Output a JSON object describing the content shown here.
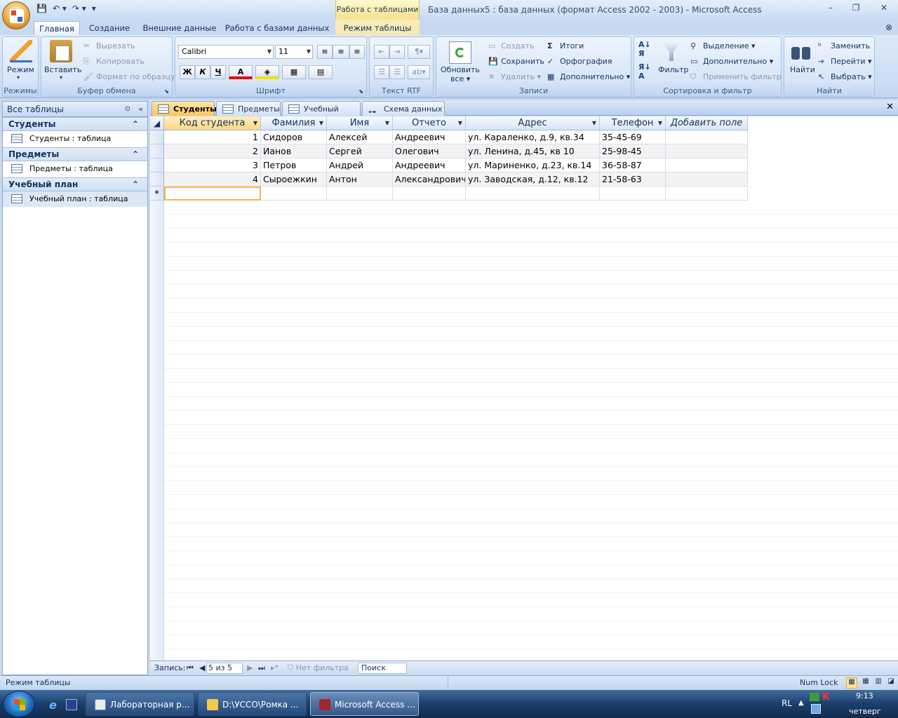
{
  "titlebar": {
    "contextual_title": "Работа с таблицами",
    "window_title": "База данных5 : база данных (формат Access 2002 - 2003)  -  Microsoft Access"
  },
  "ribbon_tabs": [
    "Главная",
    "Создание",
    "Внешние данные",
    "Работа с базами данных",
    "Режим таблицы"
  ],
  "groups": {
    "views": {
      "label": "Режимы",
      "mode": "Режим"
    },
    "clipboard": {
      "label": "Буфер обмена",
      "paste": "Вставить",
      "cut": "Вырезать",
      "copy": "Копировать",
      "format_painter": "Формат по образцу"
    },
    "font": {
      "label": "Шрифт",
      "font_name": "Calibri",
      "font_size": "11",
      "bold": "Ж",
      "italic": "К",
      "underline": "Ч",
      "font_color": "A"
    },
    "rtf": {
      "label": "Текст RTF"
    },
    "records": {
      "label": "Записи",
      "refresh": "Обновить",
      "refresh2": "все",
      "new": "Создать",
      "save": "Сохранить",
      "delete": "Удалить",
      "totals": "Итоги",
      "spelling": "Орфография",
      "more": "Дополнительно"
    },
    "sort_filter": {
      "label": "Сортировка и фильтр",
      "filter": "Фильтр",
      "selection": "Выделение",
      "advanced": "Дополнительно",
      "toggle": "Применить фильтр"
    },
    "find": {
      "label": "Найти",
      "find": "Найти",
      "replace": "Заменить",
      "goto": "Перейти",
      "select": "Выбрать"
    }
  },
  "nav": {
    "header": "Все таблицы",
    "groups": [
      {
        "name": "Студенты",
        "item": "Студенты : таблица"
      },
      {
        "name": "Предметы",
        "item": "Предметы : таблица"
      },
      {
        "name": "Учебный план",
        "item": "Учебный план : таблица"
      }
    ]
  },
  "doc_tabs": [
    "Студенты",
    "Предметы",
    "Учебный план",
    "Схема данных"
  ],
  "table": {
    "columns": [
      "Код студента",
      "Фамилия",
      "Имя",
      "Отчето",
      "Адрес",
      "Телефон",
      "Добавить поле"
    ],
    "rows": [
      [
        "1",
        "Сидоров",
        "Алексей",
        "Андреевич",
        "ул. Караленко, д.9, кв.34",
        "35-45-69"
      ],
      [
        "2",
        "Ианов",
        "Сергей",
        "Олегович",
        "ул. Ленина, д.45, кв 10",
        "25-98-45"
      ],
      [
        "3",
        "Петров",
        "Андрей",
        "Андреевич",
        "ул. Мариненко, д.23, кв.14",
        "36-58-87"
      ],
      [
        "4",
        "Сыроежкин",
        "Антон",
        "Александрович",
        "ул. Заводская, д.12, кв.12",
        "21-58-63"
      ]
    ],
    "new_row_marker": "*"
  },
  "record_nav": {
    "label": "Запись:",
    "position": "5 из 5",
    "no_filter": "Нет фильтра",
    "search": "Поиск"
  },
  "status": {
    "left": "Режим таблицы",
    "numlock": "Num Lock"
  },
  "taskbar": {
    "items": [
      "Лабораторная р...",
      "D:\\УССО\\Ромка ...",
      "Microsoft Access ..."
    ],
    "lang": "RL",
    "time": "9:13",
    "day": "четверг"
  }
}
